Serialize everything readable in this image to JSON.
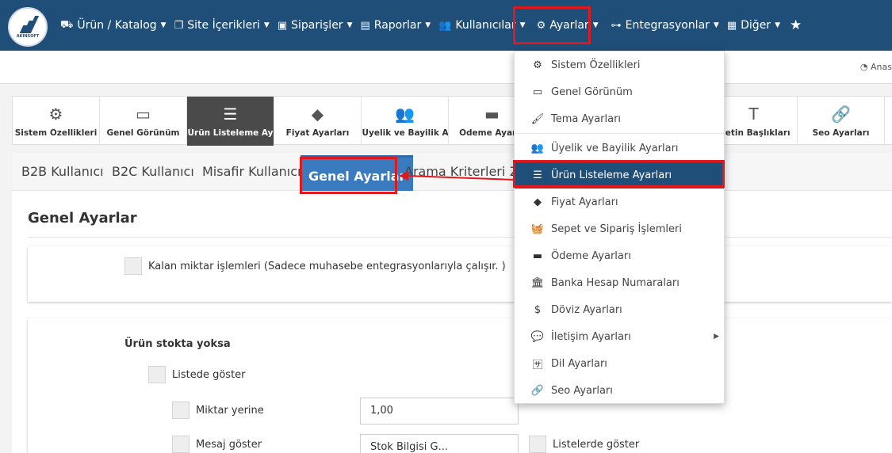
{
  "navbar": {
    "logo_text": "AKINSOFT",
    "items": [
      {
        "icon": "truck-icon",
        "label": "Ürün / Katalog"
      },
      {
        "icon": "copy-icon",
        "label": "Site İçerikleri"
      },
      {
        "icon": "delivery-icon",
        "label": "Siparişler"
      },
      {
        "icon": "file-icon",
        "label": "Raporlar"
      },
      {
        "icon": "users-icon",
        "label": "Kullanıcılar"
      },
      {
        "icon": "cogs-icon",
        "label": "Ayarlar"
      },
      {
        "icon": "sitemap-icon",
        "label": "Entegrasyonlar"
      },
      {
        "icon": "grid-icon",
        "label": "Diğer"
      }
    ],
    "star": "★"
  },
  "subbar": {
    "right_text": "Anas"
  },
  "icon_tabs": [
    {
      "icon": "cogs-icon",
      "label": "Sistem Özellikleri"
    },
    {
      "icon": "monitor-icon",
      "label": "Genel Görünüm"
    },
    {
      "icon": "list-icon",
      "label": "Ürün Listeleme Ayarla"
    },
    {
      "icon": "tags-icon",
      "label": "Fiyat Ayarları"
    },
    {
      "icon": "users-icon",
      "label": "Üyelik ve Bayilik Ayar"
    },
    {
      "icon": "card-icon",
      "label": "Ödeme Ayarla"
    },
    {
      "icon": "text-height-icon",
      "label": "Metin Başlıkları"
    },
    {
      "icon": "link-icon",
      "label": "Seo Ayarları"
    }
  ],
  "sub_tabs": [
    "B2B Kullanıcı",
    "B2C Kullanıcı",
    "Misafir Kullanıcı",
    "Genel Ayarlar",
    "Arama Kriterleri",
    "Z"
  ],
  "section_title": "Genel Ayarlar",
  "form": {
    "remaining_qty": "Kalan miktar işlemleri (Sadece muhasebe entegrasyonlarıyla çalışır. )",
    "out_of_stock_heading": "Ürün stokta yoksa",
    "show_in_list": "Listede göster",
    "instead_of_qty": "Miktar yerine",
    "qty_value": "1,00",
    "row3_label": "Mesaj göster",
    "row3_value": "Stok Bilgisi G...",
    "row3_right": "Listelerde göster"
  },
  "dropdown": [
    {
      "icon": "cogs-icon",
      "label": "Sistem Özellikleri"
    },
    {
      "icon": "monitor-icon",
      "label": "Genel Görünüm"
    },
    {
      "icon": "brush-icon",
      "label": "Tema Ayarları"
    },
    {
      "icon": "users-icon",
      "label": "Üyelik ve Bayilik Ayarları"
    },
    {
      "icon": "list-icon",
      "label": "Ürün Listeleme Ayarları"
    },
    {
      "icon": "tags-icon",
      "label": "Fiyat Ayarları"
    },
    {
      "icon": "basket-icon",
      "label": "Sepet ve Sipariş İşlemleri"
    },
    {
      "icon": "card-icon",
      "label": "Ödeme Ayarları"
    },
    {
      "icon": "bank-icon",
      "label": "Banka Hesap Numaraları"
    },
    {
      "icon": "dollar-icon",
      "label": "Döviz Ayarları"
    },
    {
      "icon": "comments-icon",
      "label": "İletişim Ayarları"
    },
    {
      "icon": "language-icon",
      "label": "Dil Ayarları"
    },
    {
      "icon": "link-icon",
      "label": "Seo Ayarları"
    }
  ],
  "colors": {
    "navbar": "#1f4e79",
    "active_tab": "#3a7bbf",
    "highlight": "#e0191e"
  }
}
